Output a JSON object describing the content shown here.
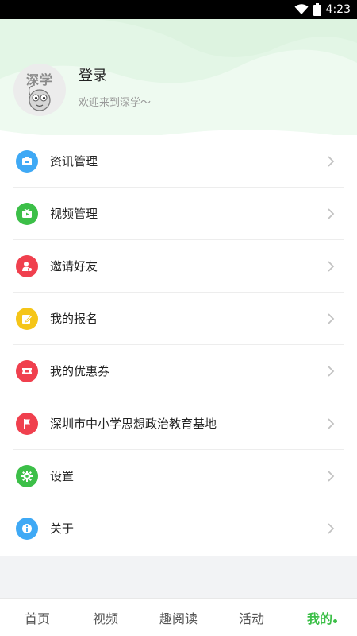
{
  "status_bar": {
    "time": "4:23"
  },
  "profile": {
    "avatar_text": "深学",
    "login_label": "登录",
    "welcome_text": "欢迎来到深学〜"
  },
  "menu": {
    "items": [
      {
        "label": "资讯管理",
        "icon": "news-icon",
        "color": "#3fa9f5"
      },
      {
        "label": "视频管理",
        "icon": "video-icon",
        "color": "#3cbf48"
      },
      {
        "label": "邀请好友",
        "icon": "invite-friend-icon",
        "color": "#f0404e"
      },
      {
        "label": "我的报名",
        "icon": "signup-edit-icon",
        "color": "#f5c518"
      },
      {
        "label": "我的优惠券",
        "icon": "coupon-icon",
        "color": "#f0404e"
      },
      {
        "label": "深圳市中小学思想政治教育基地",
        "icon": "flag-icon",
        "color": "#f0404e"
      },
      {
        "label": "设置",
        "icon": "gear-icon",
        "color": "#3cbf48"
      },
      {
        "label": "关于",
        "icon": "info-icon",
        "color": "#3fa9f5"
      }
    ]
  },
  "tabbar": {
    "tabs": [
      {
        "label": "首页"
      },
      {
        "label": "视频"
      },
      {
        "label": "趣阅读"
      },
      {
        "label": "活动"
      },
      {
        "label": "我的",
        "active": true
      }
    ],
    "accent_color": "#3cbf48"
  }
}
